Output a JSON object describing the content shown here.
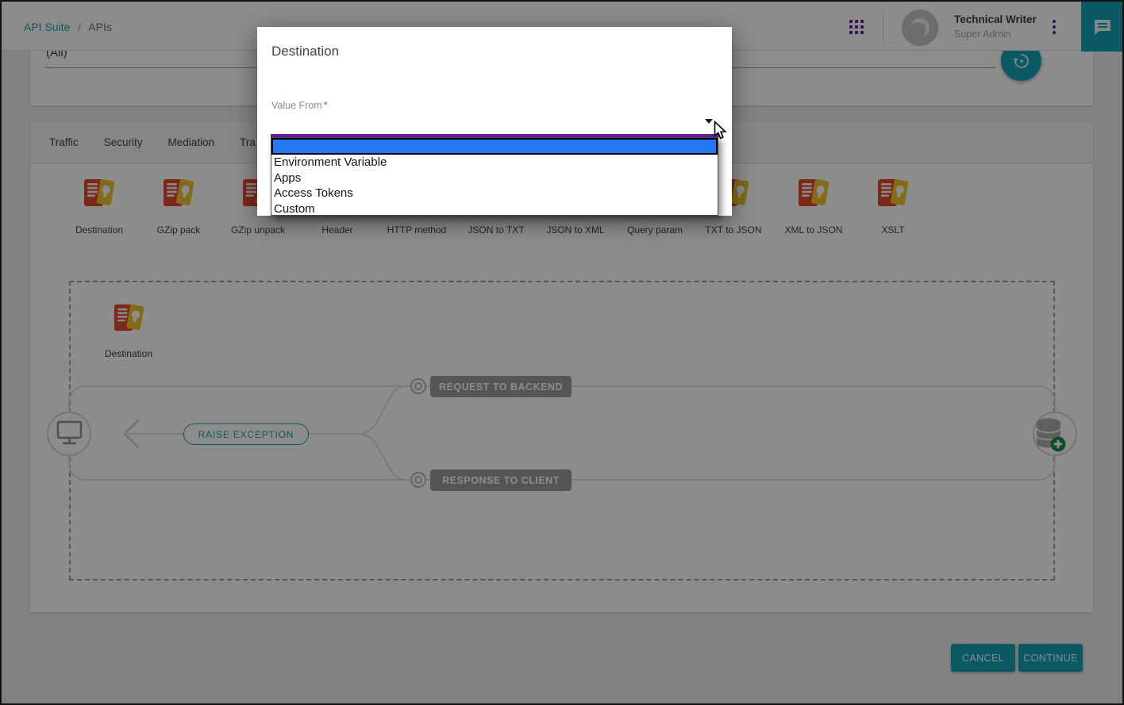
{
  "colors": {
    "accent_teal": "#14a2b5",
    "brand_purple": "#6a1b9a",
    "select_highlight_blue": "#2277f3",
    "focus_underline_purple": "#6a1b9a",
    "policy_icon_red": "#e2492f",
    "policy_icon_yellow": "#eec32a",
    "add_badge_green": "#1e8e4c",
    "flow_box_gray": "#9c9c9c"
  },
  "header": {
    "breadcrumb": {
      "root": "API Suite",
      "separator": "/",
      "current": "APIs"
    },
    "user": {
      "name": "Technical Writer",
      "role": "Super Admin"
    }
  },
  "filter": {
    "value": "(All)"
  },
  "tabs": {
    "items": [
      "Traffic",
      "Security",
      "Mediation",
      "Tra"
    ]
  },
  "palette": {
    "items": [
      "Destination",
      "GZip pack",
      "GZip unpack",
      "Header",
      "HTTP method",
      "JSON to TXT",
      "JSON to XML",
      "Query param",
      "TXT to JSON",
      "XML to JSON",
      "XSLT"
    ]
  },
  "canvas": {
    "node_label": "Destination",
    "flow": {
      "request": "REQUEST TO BACKEND",
      "exception": "RAISE EXCEPTION",
      "response": "RESPONSE TO CLIENT"
    }
  },
  "actions": {
    "cancel": "CANCEL",
    "continue": "CONTINUE"
  },
  "modal": {
    "title": "Destination",
    "field": {
      "label": "Value From",
      "required_mark": "*"
    },
    "dropdown": {
      "selected": "",
      "options": [
        "Environment Variable",
        "Apps",
        "Access Tokens",
        "Custom"
      ]
    }
  }
}
